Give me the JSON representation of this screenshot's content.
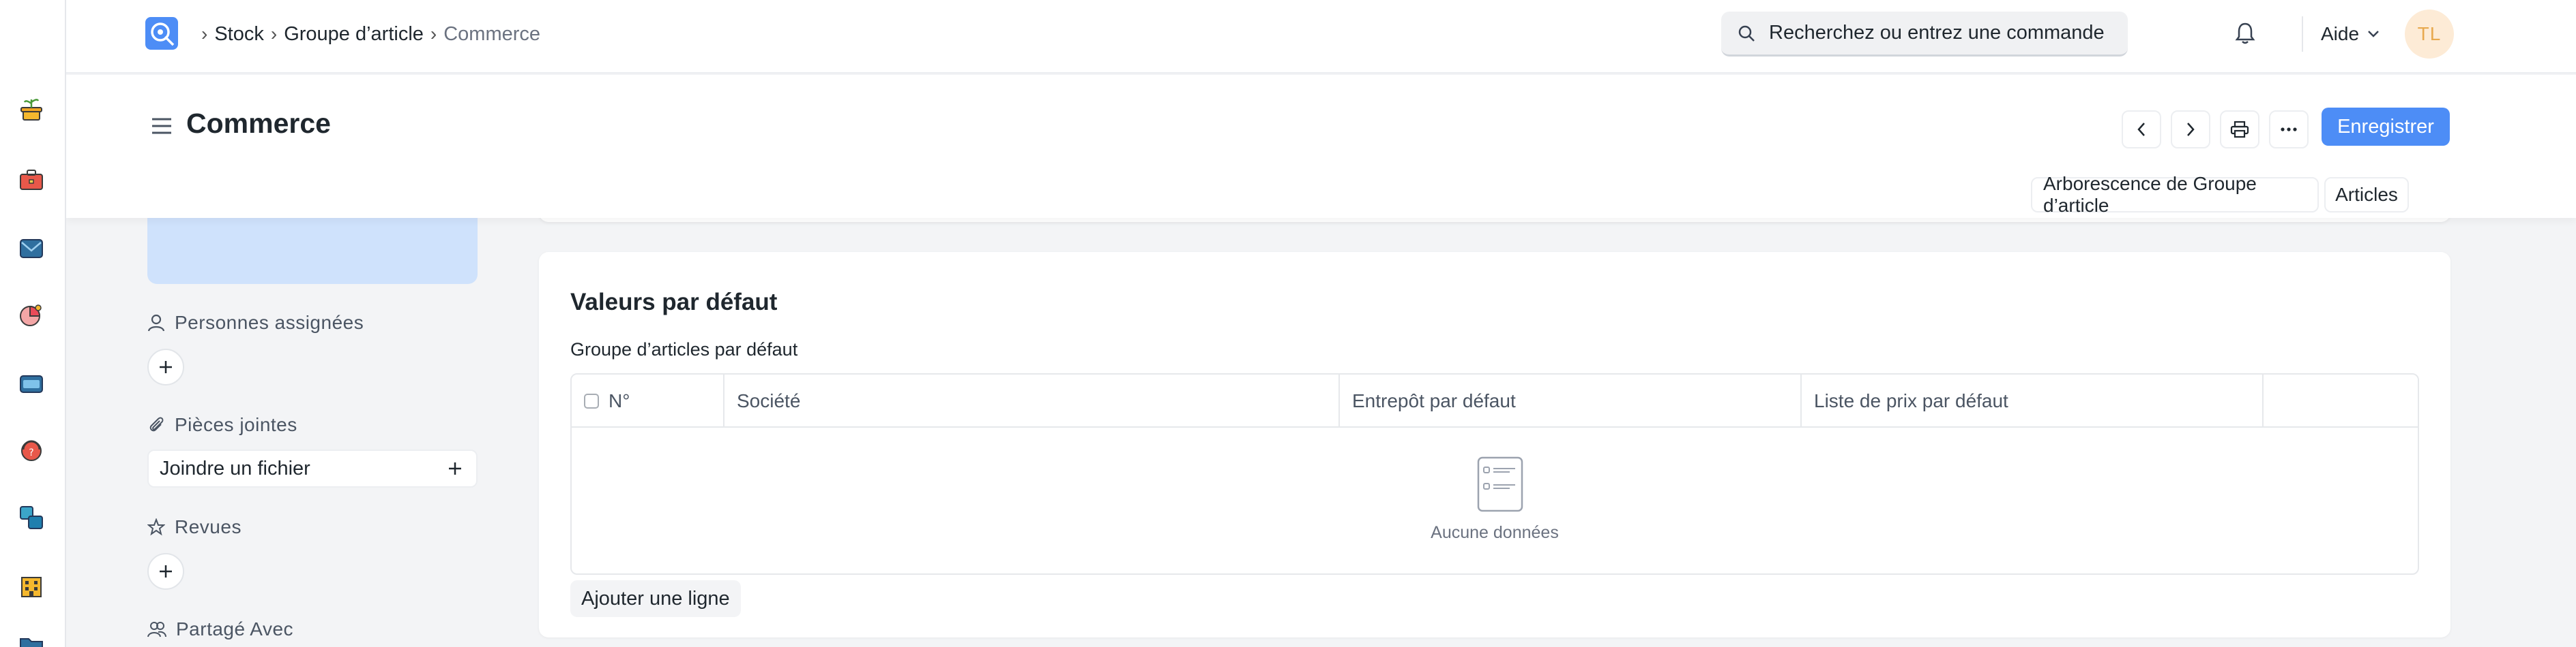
{
  "breadcrumbs": [
    "Stock",
    "Groupe d’article",
    "Commerce"
  ],
  "search": {
    "placeholder": "Recherchez ou entrez une commande"
  },
  "navbar": {
    "help_label": "Aide",
    "avatar_initials": "TL"
  },
  "page": {
    "title": "Commerce"
  },
  "actions": {
    "save_label": "Enregistrer",
    "links": [
      "Arborescence de Groupe d’article",
      "Articles"
    ]
  },
  "sidebar": {
    "assigned_label": "Personnes assignées",
    "attachments_label": "Pièces jointes",
    "attach_button": "Joindre un fichier",
    "reviews_label": "Revues",
    "shared_label": "Partagé Avec"
  },
  "rail": {
    "icons": [
      "plant-pot-icon",
      "toolbox-icon",
      "mail-icon",
      "pie-chart-icon",
      "monitor-icon",
      "support-icon",
      "shapes-icon",
      "building-icon",
      "folder-icon"
    ]
  },
  "section": {
    "title": "Valeurs par défaut",
    "field_label": "Groupe d’articles par défaut",
    "columns": [
      "N°",
      "Société",
      "Entrepôt par défaut",
      "Liste de prix par défaut"
    ],
    "empty_text": "Aucune données",
    "add_row": "Ajouter une ligne"
  },
  "colors": {
    "accent": "#4d8df6",
    "avatar_bg": "#fdebd6",
    "avatar_fg": "#e8a94f"
  }
}
